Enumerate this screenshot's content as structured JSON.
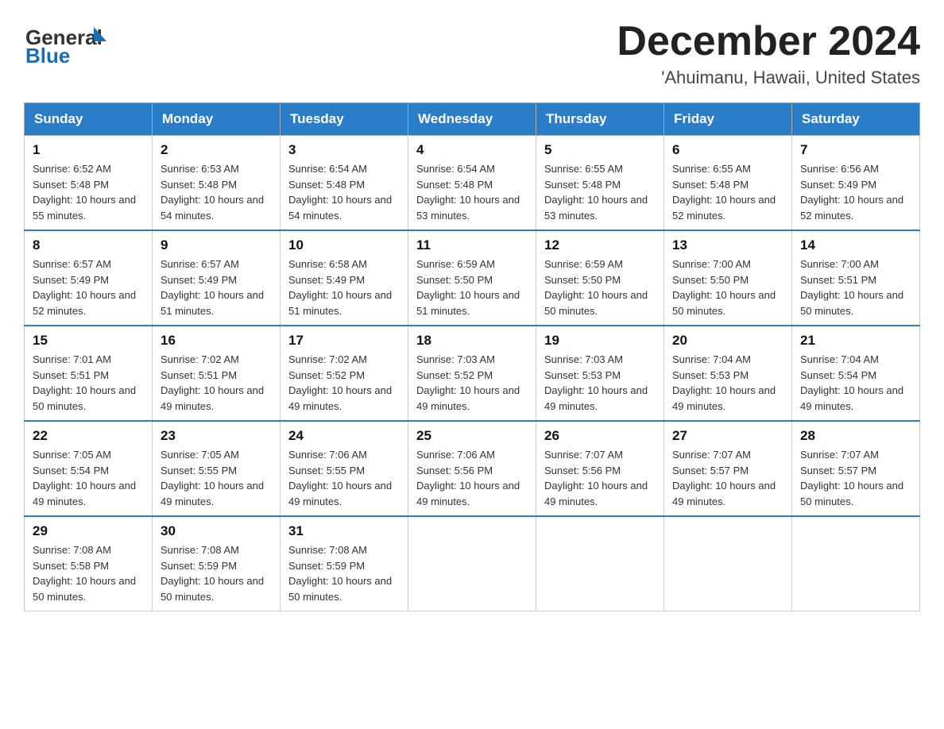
{
  "header": {
    "logo_line1": "General",
    "logo_line2": "Blue",
    "month": "December 2024",
    "location": "'Ahuimanu, Hawaii, United States"
  },
  "days_of_week": [
    "Sunday",
    "Monday",
    "Tuesday",
    "Wednesday",
    "Thursday",
    "Friday",
    "Saturday"
  ],
  "weeks": [
    [
      {
        "num": "1",
        "sunrise": "6:52 AM",
        "sunset": "5:48 PM",
        "daylight": "10 hours and 55 minutes."
      },
      {
        "num": "2",
        "sunrise": "6:53 AM",
        "sunset": "5:48 PM",
        "daylight": "10 hours and 54 minutes."
      },
      {
        "num": "3",
        "sunrise": "6:54 AM",
        "sunset": "5:48 PM",
        "daylight": "10 hours and 54 minutes."
      },
      {
        "num": "4",
        "sunrise": "6:54 AM",
        "sunset": "5:48 PM",
        "daylight": "10 hours and 53 minutes."
      },
      {
        "num": "5",
        "sunrise": "6:55 AM",
        "sunset": "5:48 PM",
        "daylight": "10 hours and 53 minutes."
      },
      {
        "num": "6",
        "sunrise": "6:55 AM",
        "sunset": "5:48 PM",
        "daylight": "10 hours and 52 minutes."
      },
      {
        "num": "7",
        "sunrise": "6:56 AM",
        "sunset": "5:49 PM",
        "daylight": "10 hours and 52 minutes."
      }
    ],
    [
      {
        "num": "8",
        "sunrise": "6:57 AM",
        "sunset": "5:49 PM",
        "daylight": "10 hours and 52 minutes."
      },
      {
        "num": "9",
        "sunrise": "6:57 AM",
        "sunset": "5:49 PM",
        "daylight": "10 hours and 51 minutes."
      },
      {
        "num": "10",
        "sunrise": "6:58 AM",
        "sunset": "5:49 PM",
        "daylight": "10 hours and 51 minutes."
      },
      {
        "num": "11",
        "sunrise": "6:59 AM",
        "sunset": "5:50 PM",
        "daylight": "10 hours and 51 minutes."
      },
      {
        "num": "12",
        "sunrise": "6:59 AM",
        "sunset": "5:50 PM",
        "daylight": "10 hours and 50 minutes."
      },
      {
        "num": "13",
        "sunrise": "7:00 AM",
        "sunset": "5:50 PM",
        "daylight": "10 hours and 50 minutes."
      },
      {
        "num": "14",
        "sunrise": "7:00 AM",
        "sunset": "5:51 PM",
        "daylight": "10 hours and 50 minutes."
      }
    ],
    [
      {
        "num": "15",
        "sunrise": "7:01 AM",
        "sunset": "5:51 PM",
        "daylight": "10 hours and 50 minutes."
      },
      {
        "num": "16",
        "sunrise": "7:02 AM",
        "sunset": "5:51 PM",
        "daylight": "10 hours and 49 minutes."
      },
      {
        "num": "17",
        "sunrise": "7:02 AM",
        "sunset": "5:52 PM",
        "daylight": "10 hours and 49 minutes."
      },
      {
        "num": "18",
        "sunrise": "7:03 AM",
        "sunset": "5:52 PM",
        "daylight": "10 hours and 49 minutes."
      },
      {
        "num": "19",
        "sunrise": "7:03 AM",
        "sunset": "5:53 PM",
        "daylight": "10 hours and 49 minutes."
      },
      {
        "num": "20",
        "sunrise": "7:04 AM",
        "sunset": "5:53 PM",
        "daylight": "10 hours and 49 minutes."
      },
      {
        "num": "21",
        "sunrise": "7:04 AM",
        "sunset": "5:54 PM",
        "daylight": "10 hours and 49 minutes."
      }
    ],
    [
      {
        "num": "22",
        "sunrise": "7:05 AM",
        "sunset": "5:54 PM",
        "daylight": "10 hours and 49 minutes."
      },
      {
        "num": "23",
        "sunrise": "7:05 AM",
        "sunset": "5:55 PM",
        "daylight": "10 hours and 49 minutes."
      },
      {
        "num": "24",
        "sunrise": "7:06 AM",
        "sunset": "5:55 PM",
        "daylight": "10 hours and 49 minutes."
      },
      {
        "num": "25",
        "sunrise": "7:06 AM",
        "sunset": "5:56 PM",
        "daylight": "10 hours and 49 minutes."
      },
      {
        "num": "26",
        "sunrise": "7:07 AM",
        "sunset": "5:56 PM",
        "daylight": "10 hours and 49 minutes."
      },
      {
        "num": "27",
        "sunrise": "7:07 AM",
        "sunset": "5:57 PM",
        "daylight": "10 hours and 49 minutes."
      },
      {
        "num": "28",
        "sunrise": "7:07 AM",
        "sunset": "5:57 PM",
        "daylight": "10 hours and 50 minutes."
      }
    ],
    [
      {
        "num": "29",
        "sunrise": "7:08 AM",
        "sunset": "5:58 PM",
        "daylight": "10 hours and 50 minutes."
      },
      {
        "num": "30",
        "sunrise": "7:08 AM",
        "sunset": "5:59 PM",
        "daylight": "10 hours and 50 minutes."
      },
      {
        "num": "31",
        "sunrise": "7:08 AM",
        "sunset": "5:59 PM",
        "daylight": "10 hours and 50 minutes."
      },
      null,
      null,
      null,
      null
    ]
  ]
}
